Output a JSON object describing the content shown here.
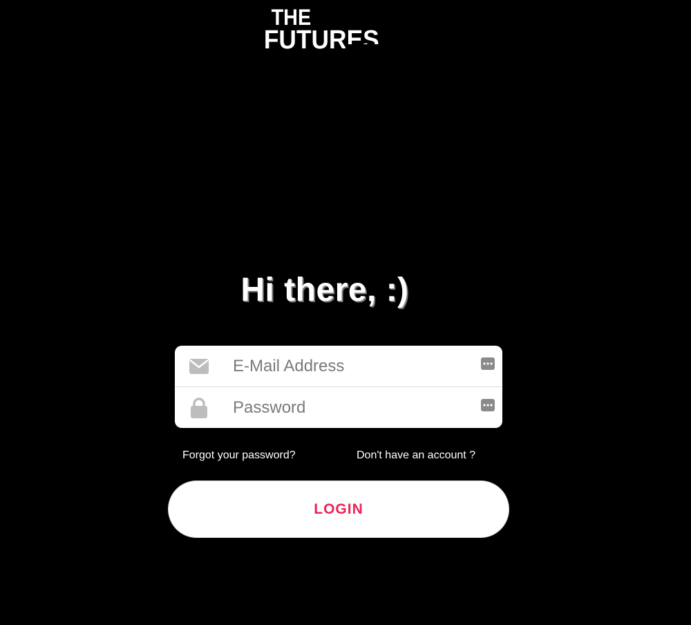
{
  "brand": {
    "logo_line1": "THE",
    "logo_line2": "FUTURES"
  },
  "greeting": "Hi there, :)",
  "form": {
    "email": {
      "placeholder": "E-Mail Address",
      "value": "",
      "icon": "envelope-icon"
    },
    "password": {
      "placeholder": "Password",
      "value": "",
      "icon": "lock-icon"
    },
    "password_manager_icon": "password-manager-icon"
  },
  "links": {
    "forgot_password": "Forgot your password?",
    "no_account": "Don't have an account ?"
  },
  "login_button": "LOGIN",
  "colors": {
    "background": "#000000",
    "card": "#ffffff",
    "accent": "#ee2255",
    "icon_gray": "#bdbdbd"
  }
}
